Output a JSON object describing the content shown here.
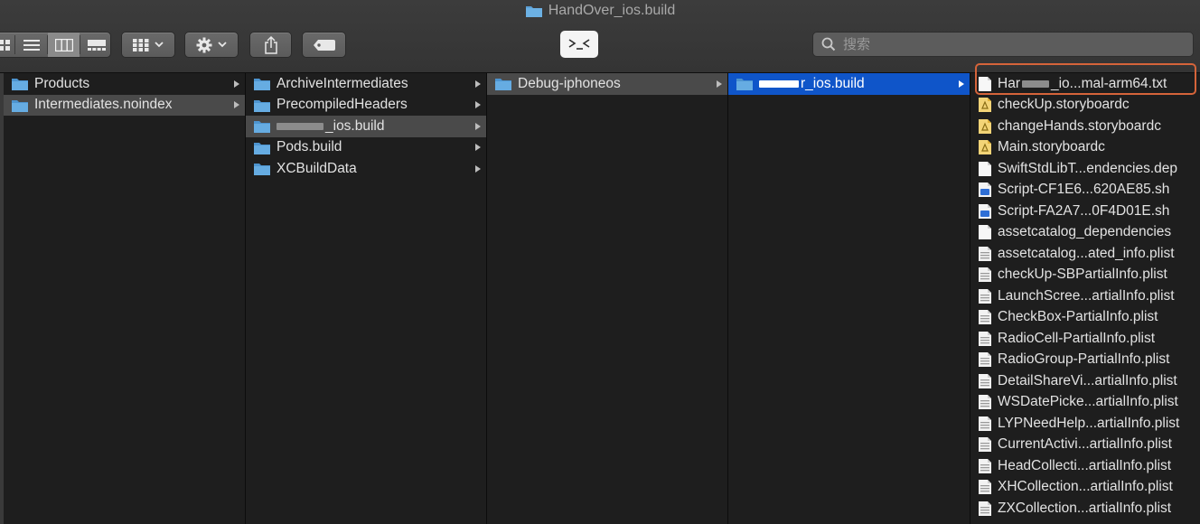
{
  "window": {
    "title": "HandOver_ios.build"
  },
  "toolbar": {
    "view_modes": [
      "icon-view",
      "list-view",
      "column-view",
      "gallery-view"
    ],
    "selected_view": "column-view",
    "group_button": "grid-icon",
    "action_button": "gear-icon",
    "share_button": "share-icon",
    "tag_button": "tag-icon",
    "terminal_button": "terminal-icon",
    "search": {
      "placeholder": "搜索",
      "value": ""
    }
  },
  "colors": {
    "folder": "#5ba0d6",
    "selected_blue": "#0f55c9",
    "selected_gray": "#4a4a4a",
    "highlight": "#d5643a",
    "storyboard": "#f0c64b"
  },
  "columns": [
    {
      "items": [
        {
          "label": "Products",
          "type": "folder",
          "has_children": true,
          "state": ""
        },
        {
          "label": "Intermediates.noindex",
          "type": "folder",
          "has_children": true,
          "state": "selected-inactive"
        }
      ]
    },
    {
      "items": [
        {
          "label": "ArchiveIntermediates",
          "type": "folder",
          "has_children": true,
          "state": ""
        },
        {
          "label": "PrecompiledHeaders",
          "type": "folder",
          "has_children": true,
          "state": ""
        },
        {
          "label": "_ios.build",
          "type": "folder",
          "has_children": true,
          "state": "selected-inactive",
          "redacted_prefix": true
        },
        {
          "label": "Pods.build",
          "type": "folder",
          "has_children": true,
          "state": ""
        },
        {
          "label": "XCBuildData",
          "type": "folder",
          "has_children": true,
          "state": ""
        }
      ]
    },
    {
      "items": [
        {
          "label": "Debug-iphoneos",
          "type": "folder",
          "has_children": true,
          "state": "selected-inactive"
        }
      ]
    },
    {
      "items": [
        {
          "label": "r_ios.build",
          "type": "folder",
          "has_children": true,
          "state": "selected-active",
          "redacted_prefix": true
        }
      ]
    },
    {
      "items": [
        {
          "label": "Har",
          "label_suffix": "_io...mal-arm64.txt",
          "type": "text",
          "state": "",
          "redacted_middle": true,
          "highlighted": true
        },
        {
          "label": "checkUp.storyboardc",
          "type": "storyboard",
          "state": ""
        },
        {
          "label": "changeHands.storyboardc",
          "type": "storyboard",
          "state": ""
        },
        {
          "label": "Main.storyboardc",
          "type": "storyboard",
          "state": ""
        },
        {
          "label": "SwiftStdLibT...endencies.dep",
          "type": "doc",
          "state": ""
        },
        {
          "label": "Script-CF1E6...620AE85.sh",
          "type": "script",
          "state": ""
        },
        {
          "label": "Script-FA2A7...0F4D01E.sh",
          "type": "script",
          "state": ""
        },
        {
          "label": "assetcatalog_dependencies",
          "type": "doc",
          "state": ""
        },
        {
          "label": "assetcatalog...ated_info.plist",
          "type": "plist",
          "state": ""
        },
        {
          "label": "checkUp-SBPartialInfo.plist",
          "type": "plist",
          "state": ""
        },
        {
          "label": "LaunchScree...artialInfo.plist",
          "type": "plist",
          "state": ""
        },
        {
          "label": "CheckBox-PartialInfo.plist",
          "type": "plist",
          "state": ""
        },
        {
          "label": "RadioCell-PartialInfo.plist",
          "type": "plist",
          "state": ""
        },
        {
          "label": "RadioGroup-PartialInfo.plist",
          "type": "plist",
          "state": ""
        },
        {
          "label": "DetailShareVi...artialInfo.plist",
          "type": "plist",
          "state": ""
        },
        {
          "label": "WSDatePicke...artialInfo.plist",
          "type": "plist",
          "state": ""
        },
        {
          "label": "LYPNeedHelp...artialInfo.plist",
          "type": "plist",
          "state": ""
        },
        {
          "label": "CurrentActivi...artialInfo.plist",
          "type": "plist",
          "state": ""
        },
        {
          "label": "HeadCollecti...artialInfo.plist",
          "type": "plist",
          "state": ""
        },
        {
          "label": "XHCollection...artialInfo.plist",
          "type": "plist",
          "state": ""
        },
        {
          "label": "ZXCollection...artialInfo.plist",
          "type": "plist",
          "state": ""
        }
      ]
    }
  ]
}
